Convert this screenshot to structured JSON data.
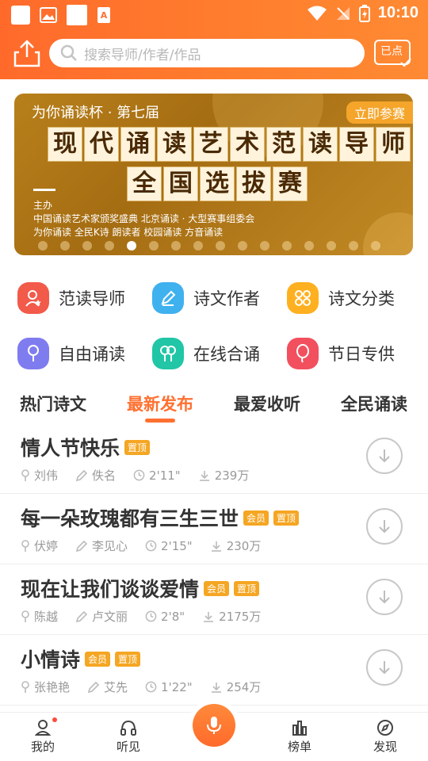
{
  "status": {
    "time": "10:10"
  },
  "search": {
    "placeholder": "搜索导师/作者/作品"
  },
  "header": {
    "signin_label": "已点"
  },
  "banner": {
    "cup": "为你诵读杯 · 第七届",
    "join": "立即参赛",
    "title1": [
      "现",
      "代",
      "诵",
      "读",
      "艺",
      "术",
      "范",
      "读",
      "导",
      "师"
    ],
    "title2": [
      "全",
      "国",
      "选",
      "拔",
      "赛"
    ],
    "host_label": "主办",
    "line1": "中国诵读艺术家颁奖盛典  北京诵读 · 大型赛事组委会",
    "line2": "为你诵读  全民K诗  朗读者  校园诵读  方音诵读",
    "dots_count": 16,
    "active_dot": 4
  },
  "categories": [
    {
      "label": "范读导师",
      "icon": "teacher-icon",
      "color": "#f25a4a"
    },
    {
      "label": "诗文作者",
      "icon": "pen-icon",
      "color": "#3fb1ef"
    },
    {
      "label": "诗文分类",
      "icon": "category-icon",
      "color": "#ffb020"
    },
    {
      "label": "自由诵读",
      "icon": "microphone-icon",
      "color": "#7f7cf0"
    },
    {
      "label": "在线合诵",
      "icon": "duo-mic-icon",
      "color": "#21c6a6"
    },
    {
      "label": "节日专供",
      "icon": "balloon-icon",
      "color": "#f2505e"
    }
  ],
  "tabs": [
    "热门诗文",
    "最新发布",
    "最爱收听",
    "全民诵读"
  ],
  "active_tab": 1,
  "items": [
    {
      "title": "情人节快乐",
      "badges": [
        "置顶"
      ],
      "reader": "刘伟",
      "author": "佚名",
      "duration": "2'11\"",
      "downloads": "239万"
    },
    {
      "title": "每一朵玫瑰都有三生三世",
      "badges": [
        "会员",
        "置顶"
      ],
      "reader": "伏婷",
      "author": "李见心",
      "duration": "2'15\"",
      "downloads": "230万"
    },
    {
      "title": "现在让我们谈谈爱情",
      "badges": [
        "会员",
        "置顶"
      ],
      "reader": "陈越",
      "author": "卢文丽",
      "duration": "2'8\"",
      "downloads": "2175万"
    },
    {
      "title": "小情诗",
      "badges": [
        "会员",
        "置顶"
      ],
      "reader": "张艳艳",
      "author": "艾先",
      "duration": "1'22\"",
      "downloads": "254万"
    }
  ],
  "nav": [
    {
      "label": "我的",
      "icon": "profile-icon"
    },
    {
      "label": "听见",
      "icon": "headphones-icon"
    },
    {
      "label": "榜单",
      "icon": "chart-icon"
    },
    {
      "label": "发现",
      "icon": "compass-icon"
    }
  ],
  "accent": "#ff7030"
}
